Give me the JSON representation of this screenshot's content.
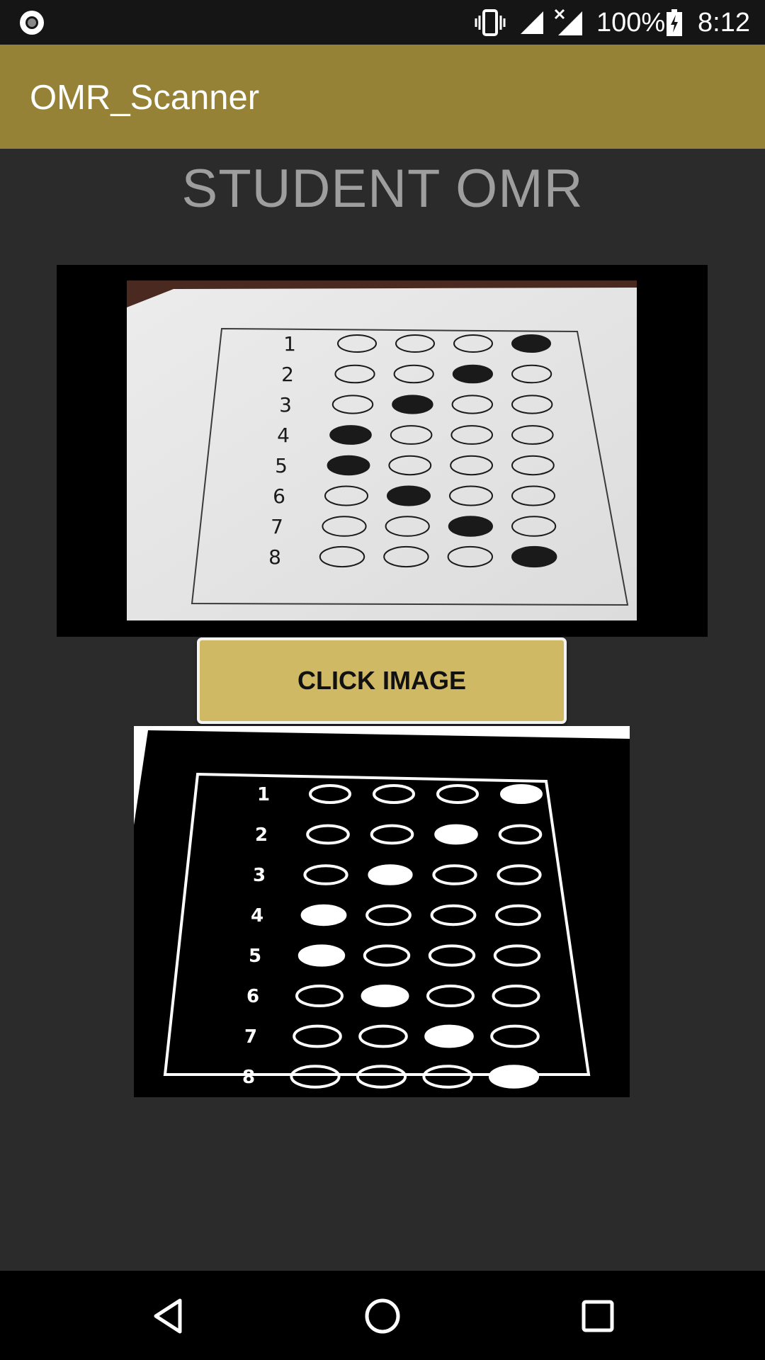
{
  "status_bar": {
    "battery": "100%",
    "time": "8:12",
    "icons": [
      "screen-record-icon",
      "vibrate-icon",
      "cell-signal-icon",
      "no-signal-icon",
      "battery-charging-icon"
    ]
  },
  "app_bar": {
    "title": "OMR_Scanner"
  },
  "main": {
    "heading": "STUDENT OMR",
    "photo": {
      "question_numbers": [
        "1",
        "2",
        "3",
        "4",
        "5",
        "6",
        "7",
        "8"
      ],
      "filled_choice_per_question": [
        4,
        3,
        2,
        1,
        1,
        2,
        3,
        4
      ]
    },
    "click_button_label": "CLICK IMAGE",
    "processed": {
      "question_numbers": [
        "1",
        "2",
        "3",
        "4",
        "5",
        "6",
        "7",
        "8"
      ],
      "filled_choice_per_question": [
        4,
        3,
        2,
        1,
        1,
        2,
        3,
        4
      ]
    }
  },
  "nav_bar": {
    "icons": [
      "back-icon",
      "home-icon",
      "recents-icon"
    ]
  },
  "colors": {
    "app_bar": "#968236",
    "button": "#cfb964",
    "background": "#2b2b2b"
  }
}
